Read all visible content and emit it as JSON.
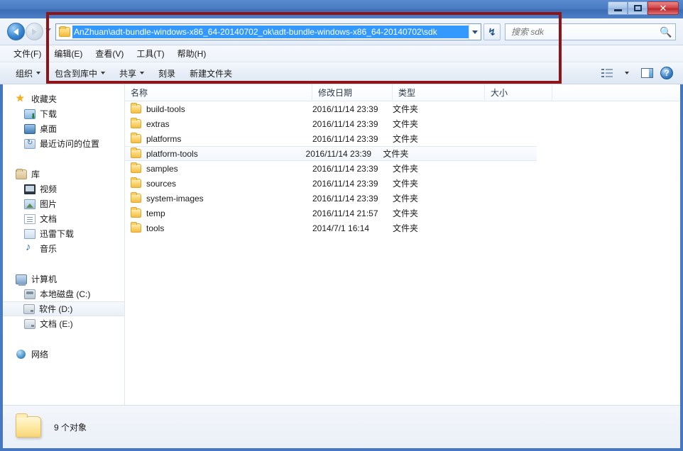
{
  "window": {
    "controls": {
      "minimize_label": "—",
      "maximize_label": "❐",
      "close_label": "✕"
    }
  },
  "navigation": {
    "back_label": "◀",
    "forward_label": "▶",
    "history_caret": "▾",
    "address_path": "AnZhuan\\adt-bundle-windows-x86_64-20140702_ok\\adt-bundle-windows-x86_64-20140702\\sdk",
    "address_dropdown": "▾",
    "refresh_label": "↯"
  },
  "search": {
    "placeholder": "搜索 sdk",
    "icon": "search-icon"
  },
  "menu": {
    "items": [
      {
        "label": "文件(F)"
      },
      {
        "label": "编辑(E)"
      },
      {
        "label": "查看(V)"
      },
      {
        "label": "工具(T)"
      },
      {
        "label": "帮助(H)"
      }
    ]
  },
  "toolbar": {
    "items": [
      {
        "label": "组织",
        "caret": true
      },
      {
        "label": "包含到库中",
        "caret": true
      },
      {
        "label": "共享",
        "caret": true
      },
      {
        "label": "刻录",
        "caret": false
      },
      {
        "label": "新建文件夹",
        "caret": false
      }
    ],
    "view_caret": "▾",
    "help_label": "?"
  },
  "sidebar": {
    "groups": [
      {
        "header": {
          "label": "收藏夹",
          "icon": "star-icon"
        },
        "items": [
          {
            "label": "下载",
            "icon": "download-icon",
            "selected": false
          },
          {
            "label": "桌面",
            "icon": "desktop-icon",
            "selected": false
          },
          {
            "label": "最近访问的位置",
            "icon": "recent-places-icon",
            "selected": false
          }
        ]
      },
      {
        "header": {
          "label": "库",
          "icon": "library-icon"
        },
        "items": [
          {
            "label": "视频",
            "icon": "video-icon",
            "selected": false
          },
          {
            "label": "图片",
            "icon": "picture-icon",
            "selected": false
          },
          {
            "label": "文档",
            "icon": "document-icon",
            "selected": false
          },
          {
            "label": "迅雷下载",
            "icon": "thunder-download-icon",
            "selected": false
          },
          {
            "label": "音乐",
            "icon": "music-icon",
            "selected": false
          }
        ]
      },
      {
        "header": {
          "label": "计算机",
          "icon": "computer-icon"
        },
        "items": [
          {
            "label": "本地磁盘 (C:)",
            "icon": "harddisk-icon",
            "selected": false
          },
          {
            "label": "软件 (D:)",
            "icon": "drive-icon",
            "selected": true
          },
          {
            "label": "文档 (E:)",
            "icon": "drive-icon",
            "selected": false
          }
        ]
      },
      {
        "header": {
          "label": "网络",
          "icon": "network-icon"
        },
        "items": []
      }
    ]
  },
  "file_list": {
    "columns": [
      {
        "label": "名称"
      },
      {
        "label": "修改日期"
      },
      {
        "label": "类型"
      },
      {
        "label": "大小"
      }
    ],
    "rows": [
      {
        "name": "build-tools",
        "date": "2016/11/14 23:39",
        "type": "文件夹",
        "size": "",
        "selected": false
      },
      {
        "name": "extras",
        "date": "2016/11/14 23:39",
        "type": "文件夹",
        "size": "",
        "selected": false
      },
      {
        "name": "platforms",
        "date": "2016/11/14 23:39",
        "type": "文件夹",
        "size": "",
        "selected": false
      },
      {
        "name": "platform-tools",
        "date": "2016/11/14 23:39",
        "type": "文件夹",
        "size": "",
        "selected": true
      },
      {
        "name": "samples",
        "date": "2016/11/14 23:39",
        "type": "文件夹",
        "size": "",
        "selected": false
      },
      {
        "name": "sources",
        "date": "2016/11/14 23:39",
        "type": "文件夹",
        "size": "",
        "selected": false
      },
      {
        "name": "system-images",
        "date": "2016/11/14 23:39",
        "type": "文件夹",
        "size": "",
        "selected": false
      },
      {
        "name": "temp",
        "date": "2016/11/14 21:57",
        "type": "文件夹",
        "size": "",
        "selected": false
      },
      {
        "name": "tools",
        "date": "2014/7/1 16:14",
        "type": "文件夹",
        "size": "",
        "selected": false
      }
    ]
  },
  "status": {
    "text": "9 个对象"
  },
  "annotation": {
    "color": "#8e1417"
  }
}
